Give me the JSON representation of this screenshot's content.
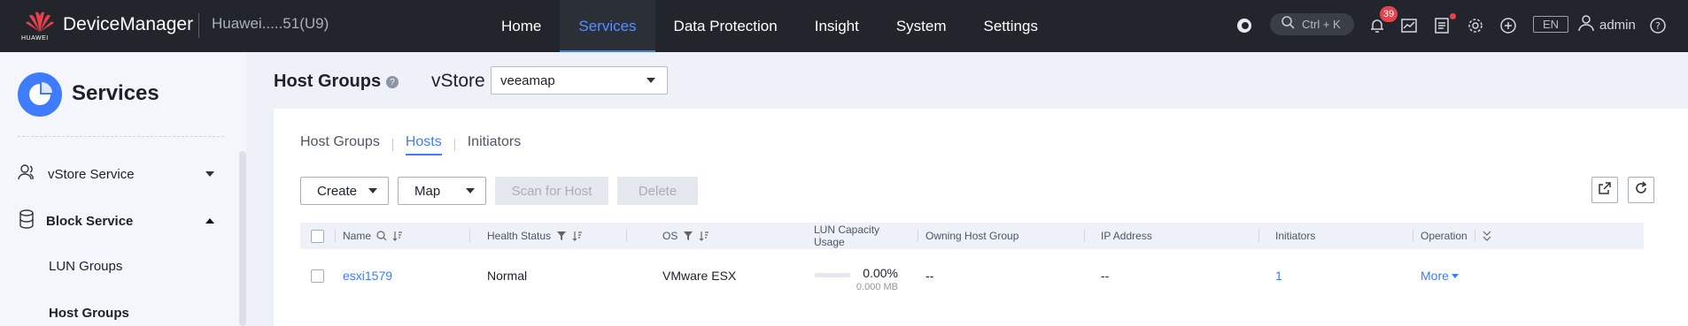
{
  "topbar": {
    "brand_text": "HUAWEI",
    "app_title": "DeviceManager",
    "device_name": "Huawei.....51(U9)",
    "nav": [
      {
        "label": "Home",
        "active": false
      },
      {
        "label": "Services",
        "active": true
      },
      {
        "label": "Data Protection",
        "active": false
      },
      {
        "label": "Insight",
        "active": false
      },
      {
        "label": "System",
        "active": false
      },
      {
        "label": "Settings",
        "active": false
      }
    ],
    "search_shortcut": "Ctrl + K",
    "alarm_count": "39",
    "language": "EN",
    "username": "admin"
  },
  "sidebar": {
    "title": "Services",
    "items": [
      {
        "label": "vStore Service",
        "expanded": false
      },
      {
        "label": "Block Service",
        "expanded": true
      }
    ],
    "sub_items": [
      {
        "label": "LUN Groups",
        "selected": false
      },
      {
        "label": "Host Groups",
        "selected": true
      }
    ]
  },
  "main": {
    "page_title": "Host Groups",
    "vstore_label": "vStore",
    "vstore_value": "veeamap",
    "tabs": [
      {
        "label": "Host Groups",
        "active": false
      },
      {
        "label": "Hosts",
        "active": true
      },
      {
        "label": "Initiators",
        "active": false
      }
    ],
    "buttons": {
      "create": "Create",
      "map": "Map",
      "scan": "Scan for Host",
      "delete": "Delete"
    },
    "table": {
      "columns": [
        "Name",
        "Health Status",
        "OS",
        "LUN Capacity Usage",
        "Owning Host Group",
        "IP Address",
        "Initiators",
        "Operation"
      ],
      "rows": [
        {
          "name": "esxi1579",
          "health": "Normal",
          "os": "VMware ESX",
          "lun_pct": "0.00%",
          "lun_size": "0.000 MB",
          "owning_group": "--",
          "ip": "--",
          "initiators": "1",
          "operation": "More"
        }
      ]
    }
  },
  "colors": {
    "accent": "#3d7bff",
    "topbar_bg": "#22252b",
    "alert": "#e8414b"
  }
}
